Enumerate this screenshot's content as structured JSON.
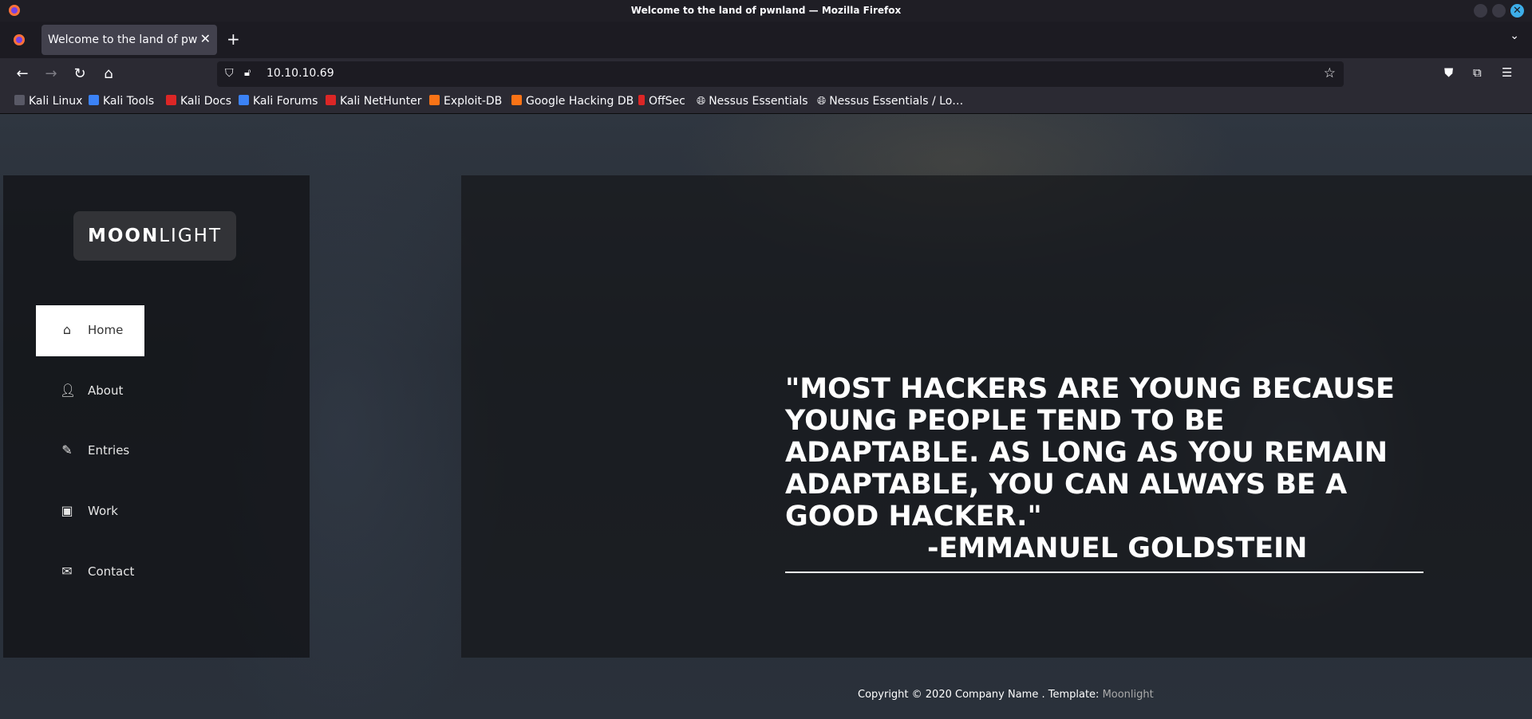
{
  "window": {
    "title": "Welcome to the land of pwnland — Mozilla Firefox"
  },
  "tabs": [
    {
      "label": "Welcome to the land of pwnland"
    }
  ],
  "toolbar": {
    "url": "10.10.10.69"
  },
  "bookmarks": [
    {
      "label": "Kali Linux",
      "color": "#2b2a33"
    },
    {
      "label": "Kali Tools",
      "color": "#3b82f6"
    },
    {
      "label": "Kali Docs",
      "color": "#dc2626"
    },
    {
      "label": "Kali Forums",
      "color": "#3b82f6"
    },
    {
      "label": "Kali NetHunter",
      "color": "#dc2626"
    },
    {
      "label": "Exploit-DB",
      "color": "#f97316"
    },
    {
      "label": "Google Hacking DB",
      "color": "#f97316"
    },
    {
      "label": "OffSec",
      "color": "#dc2626"
    },
    {
      "label": "Nessus Essentials",
      "color": "globe"
    },
    {
      "label": "Nessus Essentials / Lo…",
      "color": "globe"
    }
  ],
  "site": {
    "logo_bold": "MOON",
    "logo_light": "LIGHT",
    "nav": [
      {
        "label": "Home",
        "icon": "home-icon",
        "active": true
      },
      {
        "label": "About",
        "icon": "user-icon",
        "active": false
      },
      {
        "label": "Entries",
        "icon": "pencil-icon",
        "active": false
      },
      {
        "label": "Work",
        "icon": "image-icon",
        "active": false
      },
      {
        "label": "Contact",
        "icon": "envelope-icon",
        "active": false
      }
    ],
    "quote": "\"Most hackers are young because young people tend to be adaptable. As long as you remain adaptable, you can always be a good hacker.\"",
    "author": "-EMMANUEL GOLDSTEIN",
    "footer_text": "Copyright © 2020 Company Name . Template: ",
    "footer_link": "Moonlight"
  }
}
